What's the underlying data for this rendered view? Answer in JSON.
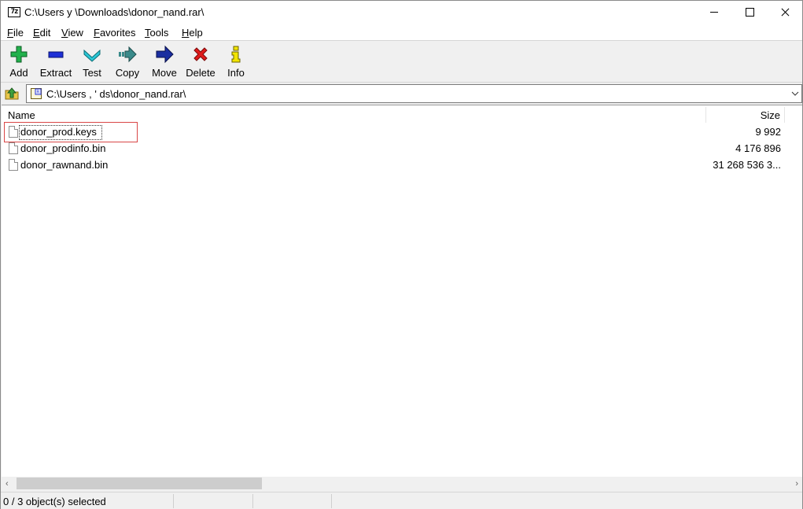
{
  "window": {
    "title": "C:\\Users  y            \\Downloads\\donor_nand.rar\\",
    "app_icon_text": "7z"
  },
  "menu": [
    {
      "label": "File",
      "accel": "F",
      "rest": "ile"
    },
    {
      "label": "Edit",
      "accel": "E",
      "rest": "dit"
    },
    {
      "label": "View",
      "accel": "V",
      "rest": "iew"
    },
    {
      "label": "Favorites",
      "accel": "F",
      "rest": "avorites"
    },
    {
      "label": "Tools",
      "accel": "T",
      "rest": "ools"
    },
    {
      "label": "Help",
      "accel": "H",
      "rest": "elp"
    }
  ],
  "toolbar": {
    "add": "Add",
    "extract": "Extract",
    "test": "Test",
    "copy": "Copy",
    "move": "Move",
    "delete": "Delete",
    "info": "Info"
  },
  "address": {
    "path": "C:\\Users  ,                         '       ds\\donor_nand.rar\\"
  },
  "columns": {
    "name": "Name",
    "size": "Size"
  },
  "files": [
    {
      "name": "donor_prod.keys",
      "size": "9 992"
    },
    {
      "name": "donor_prodinfo.bin",
      "size": "4 176 896"
    },
    {
      "name": "donor_rawnand.bin",
      "size": "31 268 536 3..."
    }
  ],
  "status": {
    "selection": "0 / 3 object(s) selected"
  },
  "colors": {
    "highlight_border": "#d94646",
    "add_icon": "#22b14c",
    "extract_icon": "#1e2fd6",
    "test_icon": "#2ac7d6",
    "copy_icon": "#3a8a8a",
    "move_icon": "#1a2ea0",
    "delete_icon": "#e01b1b",
    "info_icon": "#f2e400"
  }
}
